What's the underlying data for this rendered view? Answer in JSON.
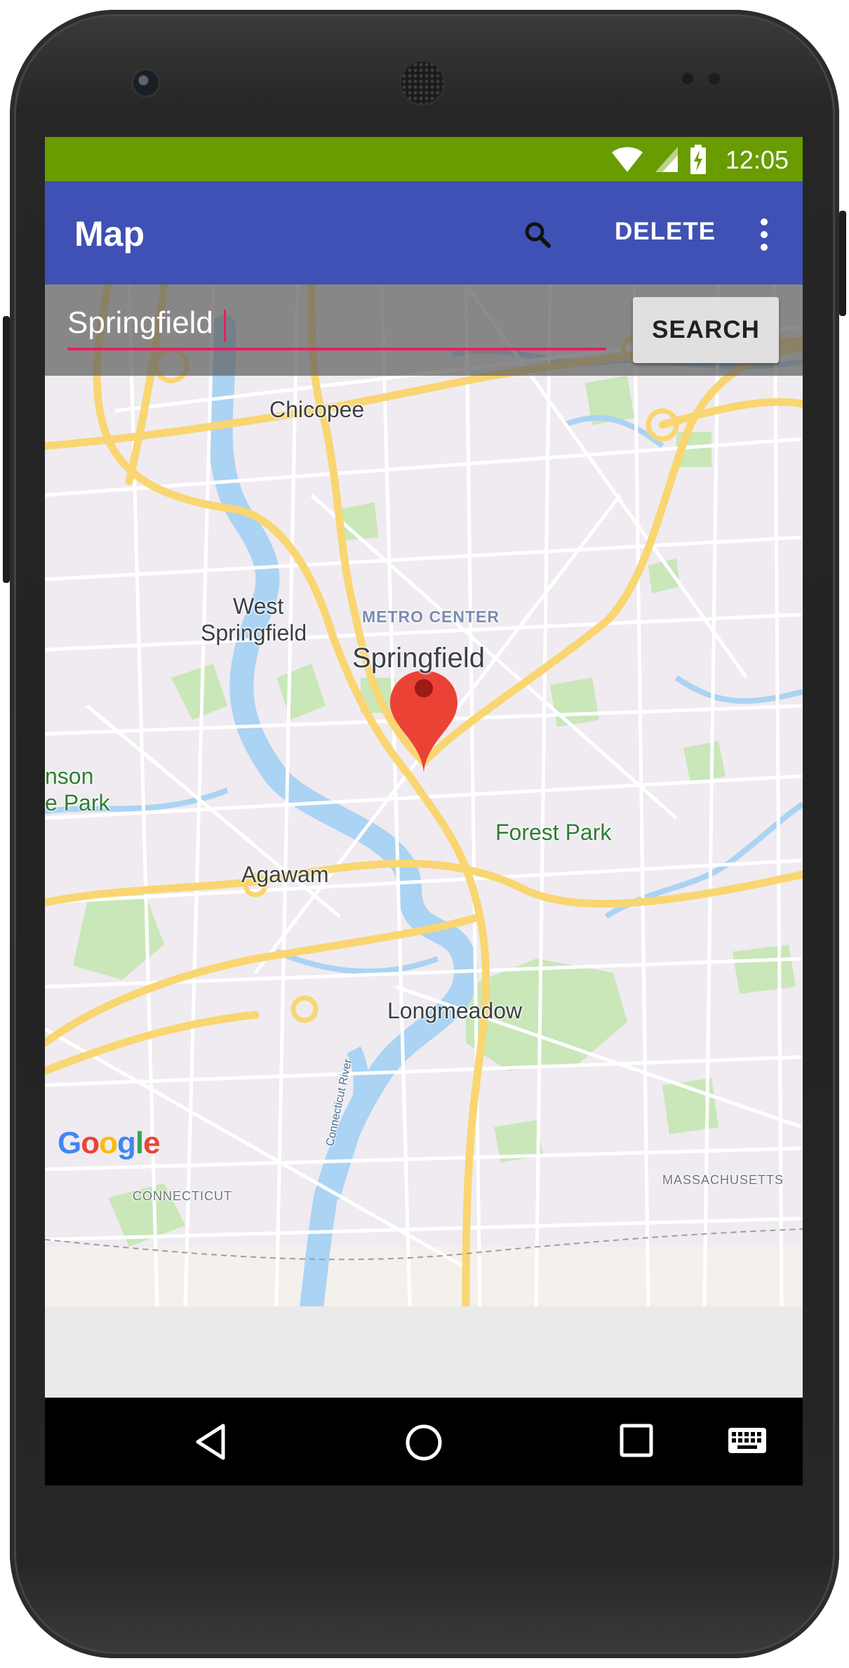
{
  "status_bar": {
    "time": "12:05",
    "color": "#689c00"
  },
  "app_bar": {
    "title": "Map",
    "search_icon": "search-icon",
    "delete_label": "DELETE",
    "more_icon": "more-vert-icon",
    "color": "#3f51b5"
  },
  "search": {
    "value": "Springfield",
    "button_label": "SEARCH",
    "underline_color": "#e91e63"
  },
  "map": {
    "labels": {
      "chicopee": "Chicopee",
      "west_springfield_line1": "West",
      "west_springfield_line2": "Springfield",
      "metro_center": "METRO CENTER",
      "springfield": "Springfield",
      "robinson_line1": "nson",
      "robinson_line2": "e Park",
      "forest_park": "Forest Park",
      "agawam": "Agawam",
      "longmeadow": "Longmeadow",
      "connecticut_river": "Connecticut River",
      "connecticut": "CONNECTICUT",
      "massachusetts": "MASSACHUSETTS"
    },
    "marker_color": "#ea4335",
    "attribution": [
      "G",
      "o",
      "o",
      "g",
      "l",
      "e"
    ]
  },
  "nav_bar": {
    "back_icon": "back-icon",
    "home_icon": "home-icon",
    "recents_icon": "recents-icon",
    "keyboard_icon": "keyboard-icon"
  }
}
